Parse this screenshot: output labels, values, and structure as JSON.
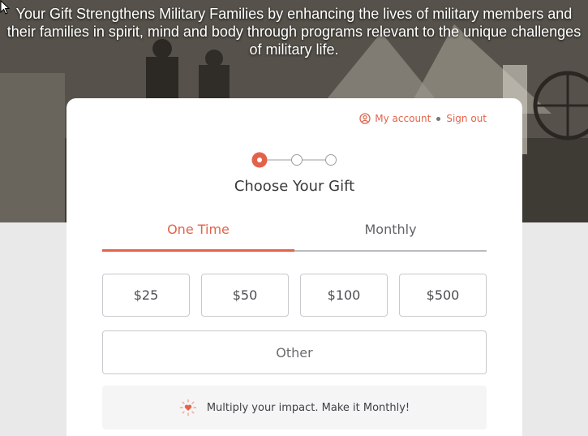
{
  "hero": {
    "text": "Your Gift Strengthens Military Families by enhancing the lives of military members and their families in spirit, mind and body through programs relevant to the unique challenges of military life."
  },
  "account": {
    "my_account": "My account",
    "sign_out": "Sign out"
  },
  "stepper": {
    "current_step": 1,
    "total_steps": 3
  },
  "step_title": "Choose Your Gift",
  "tabs": [
    {
      "label": "One Time",
      "active": true
    },
    {
      "label": "Monthly",
      "active": false
    }
  ],
  "amounts": [
    "$25",
    "$50",
    "$100",
    "$500"
  ],
  "other_label": "Other",
  "promo_text": "Multiply your impact. Make it Monthly!",
  "colors": {
    "accent": "#e3634a",
    "background": "#e9e9ea",
    "card": "#ffffff"
  },
  "icons": [
    "user-circle-icon",
    "heart-burst-icon",
    "cursor-icon"
  ]
}
